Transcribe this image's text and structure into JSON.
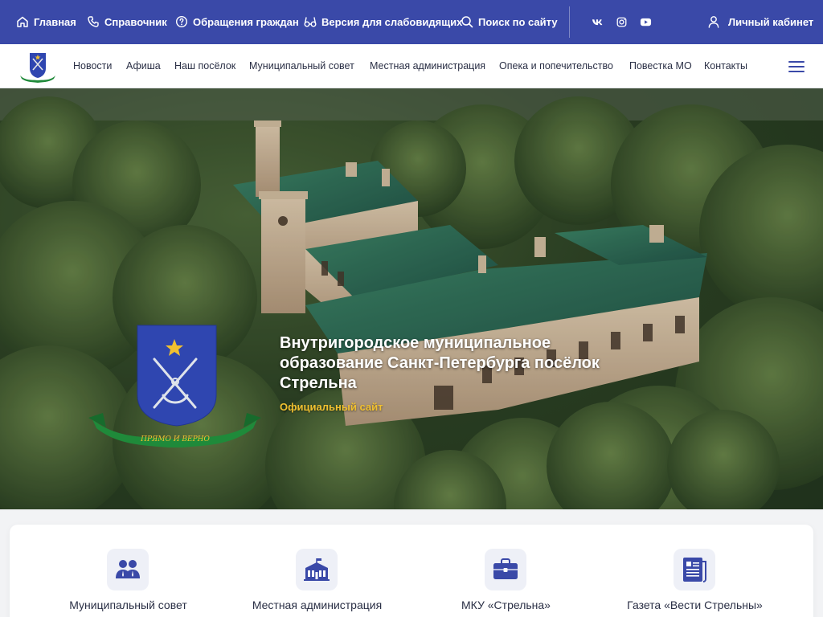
{
  "topbar": {
    "home": "Главная",
    "directory": "Справочник",
    "appeals": "Обращения граждан",
    "accessibility": "Версия для слабовидящих",
    "search": "Поиск по сайту",
    "account": "Личный кабинет",
    "social": [
      "vk-icon",
      "instagram-icon",
      "youtube-icon"
    ]
  },
  "nav": {
    "items": [
      "Новости",
      "Афиша",
      "Наш посёлок",
      "Муниципальный совет",
      "Местная администрация",
      "Опека и попечительство",
      "Повестка МО",
      "Контакты"
    ]
  },
  "hero": {
    "title": "Внутригородское муниципальное образование Санкт-Петербурга посёлок Стрельна",
    "subtitle": "Официальный сайт",
    "motto": "ПРЯМО И ВЕРНО"
  },
  "cards": [
    {
      "label": "Муниципальный совет",
      "icon": "people-icon"
    },
    {
      "label": "Местная администрация",
      "icon": "building-icon"
    },
    {
      "label": "МКУ «Стрельна»",
      "icon": "briefcase-icon"
    },
    {
      "label": "Газета «Вести Стрельны»",
      "icon": "newspaper-icon"
    }
  ],
  "colors": {
    "brand": "#3a49a8",
    "accent": "#f0c030",
    "text": "#2a2f45"
  }
}
